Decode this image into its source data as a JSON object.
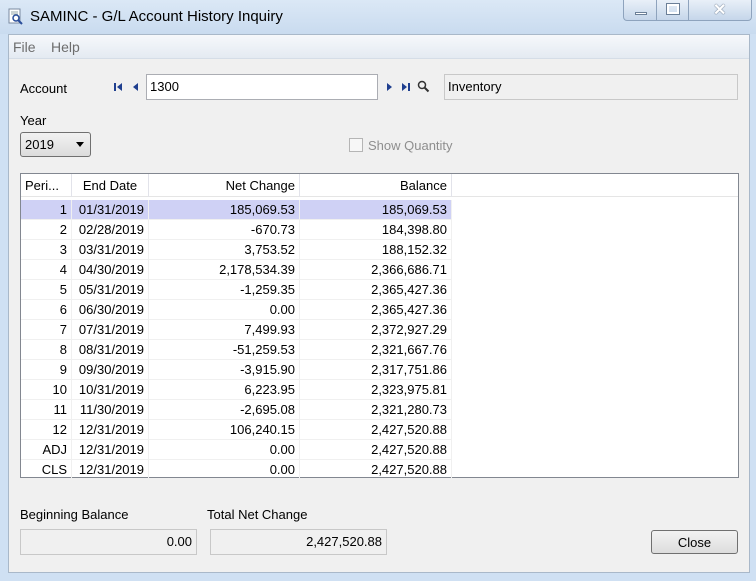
{
  "window": {
    "title": "SAMINC - G/L Account History Inquiry",
    "icon": "magnifier-document-icon"
  },
  "menu": {
    "items": [
      {
        "label": "File"
      },
      {
        "label": "Help"
      }
    ]
  },
  "account": {
    "label": "Account",
    "value": "1300",
    "description": "Inventory"
  },
  "year": {
    "label": "Year",
    "selected": "2019"
  },
  "show_quantity": {
    "label": "Show Quantity",
    "checked": false,
    "enabled": false
  },
  "table": {
    "columns": [
      "Peri...",
      "End Date",
      "Net Change",
      "Balance"
    ],
    "rows": [
      {
        "period": "1",
        "end_date": "01/31/2019",
        "net_change": "185,069.53",
        "balance": "185,069.53"
      },
      {
        "period": "2",
        "end_date": "02/28/2019",
        "net_change": "-670.73",
        "balance": "184,398.80"
      },
      {
        "period": "3",
        "end_date": "03/31/2019",
        "net_change": "3,753.52",
        "balance": "188,152.32"
      },
      {
        "period": "4",
        "end_date": "04/30/2019",
        "net_change": "2,178,534.39",
        "balance": "2,366,686.71"
      },
      {
        "period": "5",
        "end_date": "05/31/2019",
        "net_change": "-1,259.35",
        "balance": "2,365,427.36"
      },
      {
        "period": "6",
        "end_date": "06/30/2019",
        "net_change": "0.00",
        "balance": "2,365,427.36"
      },
      {
        "period": "7",
        "end_date": "07/31/2019",
        "net_change": "7,499.93",
        "balance": "2,372,927.29"
      },
      {
        "period": "8",
        "end_date": "08/31/2019",
        "net_change": "-51,259.53",
        "balance": "2,321,667.76"
      },
      {
        "period": "9",
        "end_date": "09/30/2019",
        "net_change": "-3,915.90",
        "balance": "2,317,751.86"
      },
      {
        "period": "10",
        "end_date": "10/31/2019",
        "net_change": "6,223.95",
        "balance": "2,323,975.81"
      },
      {
        "period": "11",
        "end_date": "11/30/2019",
        "net_change": "-2,695.08",
        "balance": "2,321,280.73"
      },
      {
        "period": "12",
        "end_date": "12/31/2019",
        "net_change": "106,240.15",
        "balance": "2,427,520.88"
      },
      {
        "period": "ADJ",
        "end_date": "12/31/2019",
        "net_change": "0.00",
        "balance": "2,427,520.88"
      },
      {
        "period": "CLS",
        "end_date": "12/31/2019",
        "net_change": "0.00",
        "balance": "2,427,520.88"
      }
    ],
    "selected_index": 0
  },
  "summary": {
    "beginning_balance_label": "Beginning Balance",
    "beginning_balance": "0.00",
    "total_net_change_label": "Total Net Change",
    "total_net_change": "2,427,520.88"
  },
  "buttons": {
    "close": "Close"
  },
  "colors": {
    "selection": "#cfd1f5",
    "titlebar": "#c9dbef",
    "nav_arrow": "#1f3f8f"
  }
}
